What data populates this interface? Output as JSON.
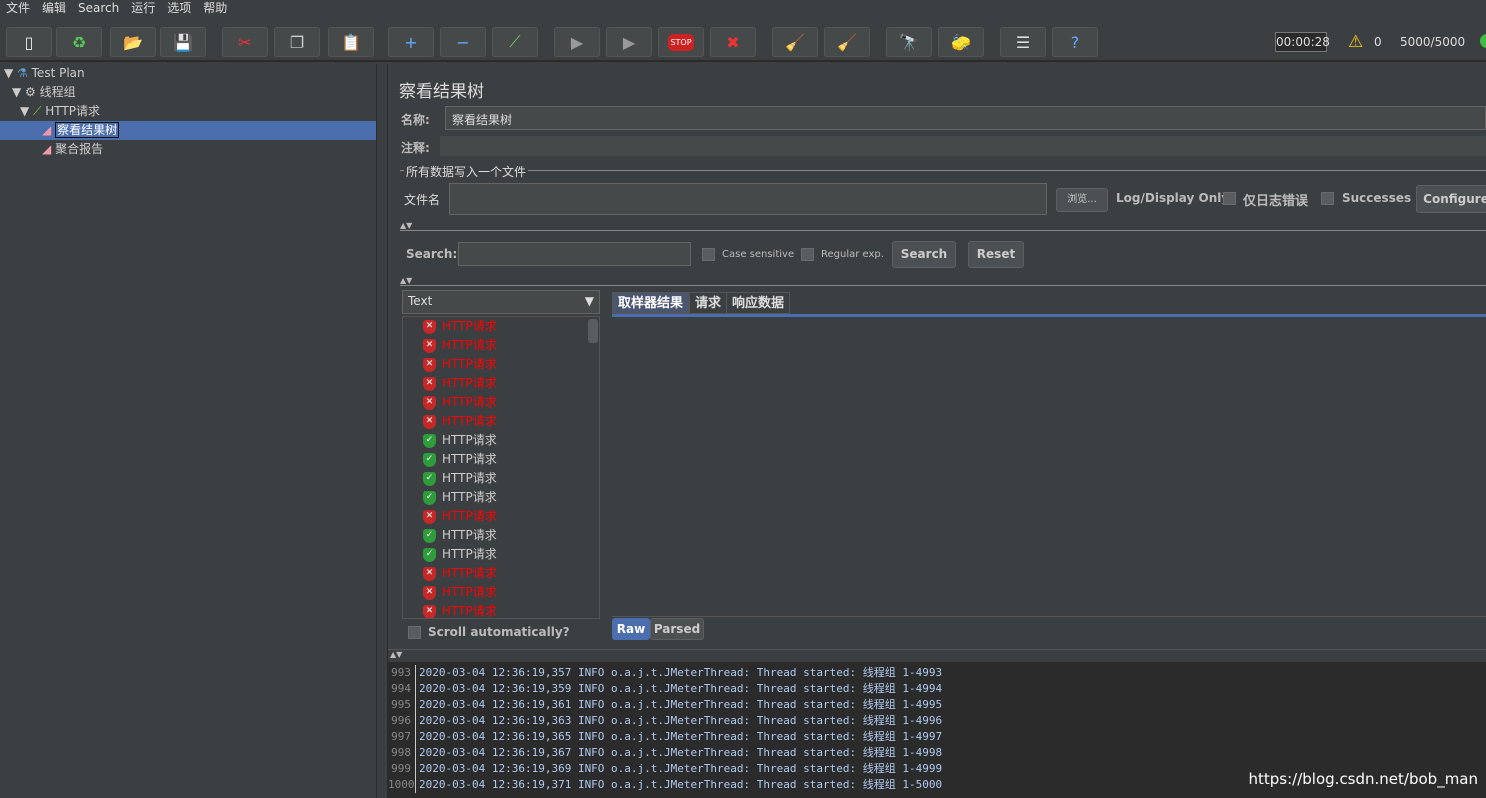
{
  "menu": [
    "文件",
    "编辑",
    "Search",
    "运行",
    "选项",
    "帮助"
  ],
  "toolbar": {
    "buttons": [
      "new-icon",
      "templates-icon",
      "open-icon",
      "save-icon",
      "cut-icon",
      "copy-icon",
      "paste-icon",
      "expand-icon",
      "collapse-icon",
      "toggle-icon",
      "start-icon",
      "start-no-pause-icon",
      "stop-icon",
      "shutdown-icon",
      "clear-icon",
      "clear-all-icon",
      "search-icon",
      "reset-search-icon",
      "function-helper-icon",
      "help-icon"
    ],
    "glyphs": [
      "▯",
      "♻",
      "📂",
      "💾",
      "✂",
      "❐",
      "📋",
      "+",
      "−",
      "⟋",
      "▶",
      "▶",
      "STOP",
      "✖",
      "🧹",
      "🧹",
      "🔭",
      "🧽",
      "☰",
      "?"
    ],
    "timer": "00:00:28",
    "warnings": "0",
    "threads": "5000/5000"
  },
  "tree": [
    {
      "label": "Test Plan"
    },
    {
      "label": "线程组"
    },
    {
      "label": "HTTP请求"
    },
    {
      "label": "察看结果树"
    },
    {
      "label": "聚合报告"
    }
  ],
  "panel": {
    "title": "察看结果树",
    "name_label": "名称:",
    "name_value": "察看结果树",
    "comment_label": "注释:",
    "comment_value": "",
    "file_group": "所有数据写入一个文件",
    "filename_label": "文件名",
    "filename_value": "",
    "browse": "浏览...",
    "log_display": "Log/Display Only:",
    "errors_only": "仅日志错误",
    "successes": "Successes",
    "configure": "Configure"
  },
  "search": {
    "label": "Search:",
    "value": "",
    "case_sensitive": "Case sensitive",
    "regex": "Regular exp.",
    "search_btn": "Search",
    "reset_btn": "Reset"
  },
  "renderer": "Text",
  "results": [
    {
      "label": "HTTP请求",
      "status": "fail"
    },
    {
      "label": "HTTP请求",
      "status": "fail"
    },
    {
      "label": "HTTP请求",
      "status": "fail"
    },
    {
      "label": "HTTP请求",
      "status": "fail"
    },
    {
      "label": "HTTP请求",
      "status": "fail"
    },
    {
      "label": "HTTP请求",
      "status": "fail"
    },
    {
      "label": "HTTP请求",
      "status": "pass"
    },
    {
      "label": "HTTP请求",
      "status": "pass"
    },
    {
      "label": "HTTP请求",
      "status": "pass"
    },
    {
      "label": "HTTP请求",
      "status": "pass"
    },
    {
      "label": "HTTP请求",
      "status": "fail"
    },
    {
      "label": "HTTP请求",
      "status": "pass"
    },
    {
      "label": "HTTP请求",
      "status": "pass"
    },
    {
      "label": "HTTP请求",
      "status": "fail"
    },
    {
      "label": "HTTP请求",
      "status": "fail"
    },
    {
      "label": "HTTP请求",
      "status": "fail"
    }
  ],
  "scroll_auto": "Scroll automatically?",
  "tabs": [
    "取样器结果",
    "请求",
    "响应数据"
  ],
  "bottom_tabs": [
    "Raw",
    "Parsed"
  ],
  "log": [
    {
      "n": "993",
      "t": "2020-03-04 12:36:19,357 INFO o.a.j.t.JMeterThread: Thread started: 线程组 1-4993"
    },
    {
      "n": "994",
      "t": "2020-03-04 12:36:19,359 INFO o.a.j.t.JMeterThread: Thread started: 线程组 1-4994"
    },
    {
      "n": "995",
      "t": "2020-03-04 12:36:19,361 INFO o.a.j.t.JMeterThread: Thread started: 线程组 1-4995"
    },
    {
      "n": "996",
      "t": "2020-03-04 12:36:19,363 INFO o.a.j.t.JMeterThread: Thread started: 线程组 1-4996"
    },
    {
      "n": "997",
      "t": "2020-03-04 12:36:19,365 INFO o.a.j.t.JMeterThread: Thread started: 线程组 1-4997"
    },
    {
      "n": "998",
      "t": "2020-03-04 12:36:19,367 INFO o.a.j.t.JMeterThread: Thread started: 线程组 1-4998"
    },
    {
      "n": "999",
      "t": "2020-03-04 12:36:19,369 INFO o.a.j.t.JMeterThread: Thread started: 线程组 1-4999"
    },
    {
      "n": "1000",
      "t": "2020-03-04 12:36:19,371 INFO o.a.j.t.JMeterThread: Thread started: 线程组 1-5000"
    }
  ],
  "watermark": "https://blog.csdn.net/bob_man"
}
